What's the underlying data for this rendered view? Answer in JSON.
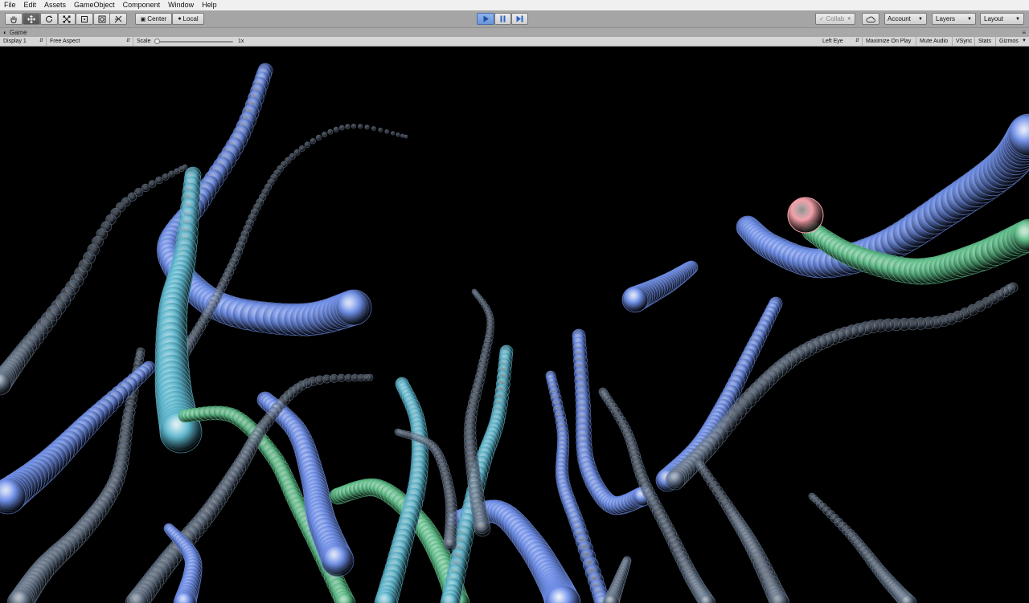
{
  "menu": {
    "items": [
      "File",
      "Edit",
      "Assets",
      "GameObject",
      "Component",
      "Window",
      "Help"
    ]
  },
  "toolbar": {
    "transform_tools": [
      "hand-tool-icon",
      "move-tool-icon",
      "rotate-tool-icon",
      "scale-tool-icon",
      "rect-tool-icon",
      "transform-tool-icon",
      "custom-tool-icon"
    ],
    "pivot_label": "Center",
    "space_label": "Local",
    "collab_label": "Collab",
    "account_label": "Account",
    "layers_label": "Layers",
    "layout_label": "Layout"
  },
  "game_tab": {
    "title": "Game"
  },
  "game_bar": {
    "display": "Display 1",
    "aspect": "Free Aspect",
    "scale_label": "Scale",
    "scale_value": "1x",
    "scale_level": 0.0,
    "eye": "Left Eye",
    "maximize": "Maximize On Play",
    "mute": "Mute Audio",
    "vsync": "VSync",
    "stats": "Stats",
    "gizmos": "Gizmos"
  },
  "colors": {
    "viewport_bg": "#000000",
    "play_active": "#7fa5e2",
    "strand_blue": "#6f8fe8",
    "strand_cyan": "#5fb9d0",
    "strand_green": "#5fbf8a",
    "strand_pink": "#f3a0a8"
  }
}
